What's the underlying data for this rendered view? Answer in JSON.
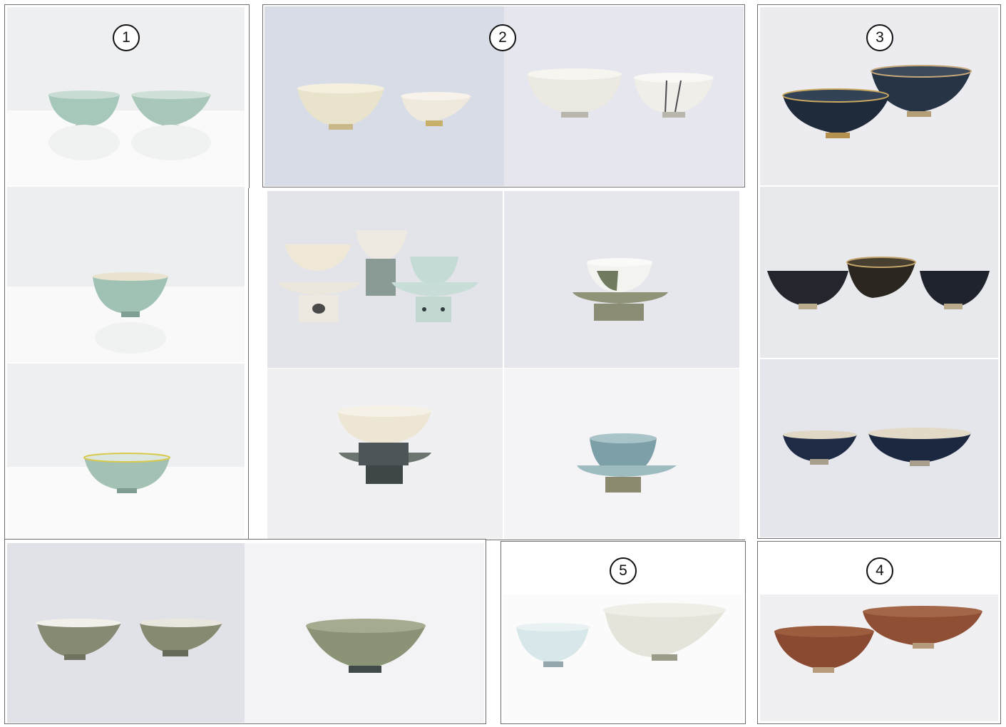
{
  "groups": [
    {
      "id": 1,
      "label": "1"
    },
    {
      "id": 2,
      "label": "2"
    },
    {
      "id": 3,
      "label": "3"
    },
    {
      "id": 4,
      "label": "4"
    },
    {
      "id": 5,
      "label": "5"
    }
  ],
  "colors": {
    "frame_border": "#6f6f6f",
    "celadon": "#a9c9bd",
    "white_porcelain": "#ece8dc",
    "black_tenmoku": "#26303f",
    "olive_celadon": "#8a9479",
    "brown_ware": "#8c4d33",
    "qingbai": "#d7e6e6"
  },
  "photos": [
    {
      "name": "photo-celadon-pair",
      "group": 1,
      "subject": "celadon-bowl-pair-icon"
    },
    {
      "name": "photo-celadon-single",
      "group": 1,
      "subject": "celadon-bowl-icon"
    },
    {
      "name": "photo-celadon-lobed",
      "group": 1,
      "subject": "lobed-celadon-bowl-icon"
    },
    {
      "name": "photo-white-pair-left",
      "group": 2,
      "subject": "white-bowl-pair-icon"
    },
    {
      "name": "photo-white-pair-right",
      "group": 2,
      "subject": "white-bowl-pair-icon"
    },
    {
      "name": "photo-cup-stands",
      "group": 2,
      "subject": "cup-stand-set-icon"
    },
    {
      "name": "photo-cup-on-stand",
      "group": 2,
      "subject": "cup-stand-icon"
    },
    {
      "name": "photo-white-cup-dark-stand",
      "group": 2,
      "subject": "cup-stand-icon"
    },
    {
      "name": "photo-blue-cup-stand",
      "group": 2,
      "subject": "cup-stand-icon"
    },
    {
      "name": "photo-tenmoku-pair",
      "group": 3,
      "subject": "black-tea-bowl-pair-icon"
    },
    {
      "name": "photo-tenmoku-trio",
      "group": 3,
      "subject": "black-tea-bowl-trio-icon"
    },
    {
      "name": "photo-tenmoku-rimmed",
      "group": 3,
      "subject": "black-tea-bowl-pair-icon"
    },
    {
      "name": "photo-olive-pair",
      "group": 1,
      "subject": "olive-bowl-pair-icon"
    },
    {
      "name": "photo-olive-conical",
      "group": 1,
      "subject": "olive-conical-bowl-icon"
    },
    {
      "name": "photo-qingbai-pair",
      "group": 5,
      "subject": "qingbai-bowl-pair-icon"
    },
    {
      "name": "photo-brown-pair",
      "group": 4,
      "subject": "brown-bowl-pair-icon"
    }
  ]
}
